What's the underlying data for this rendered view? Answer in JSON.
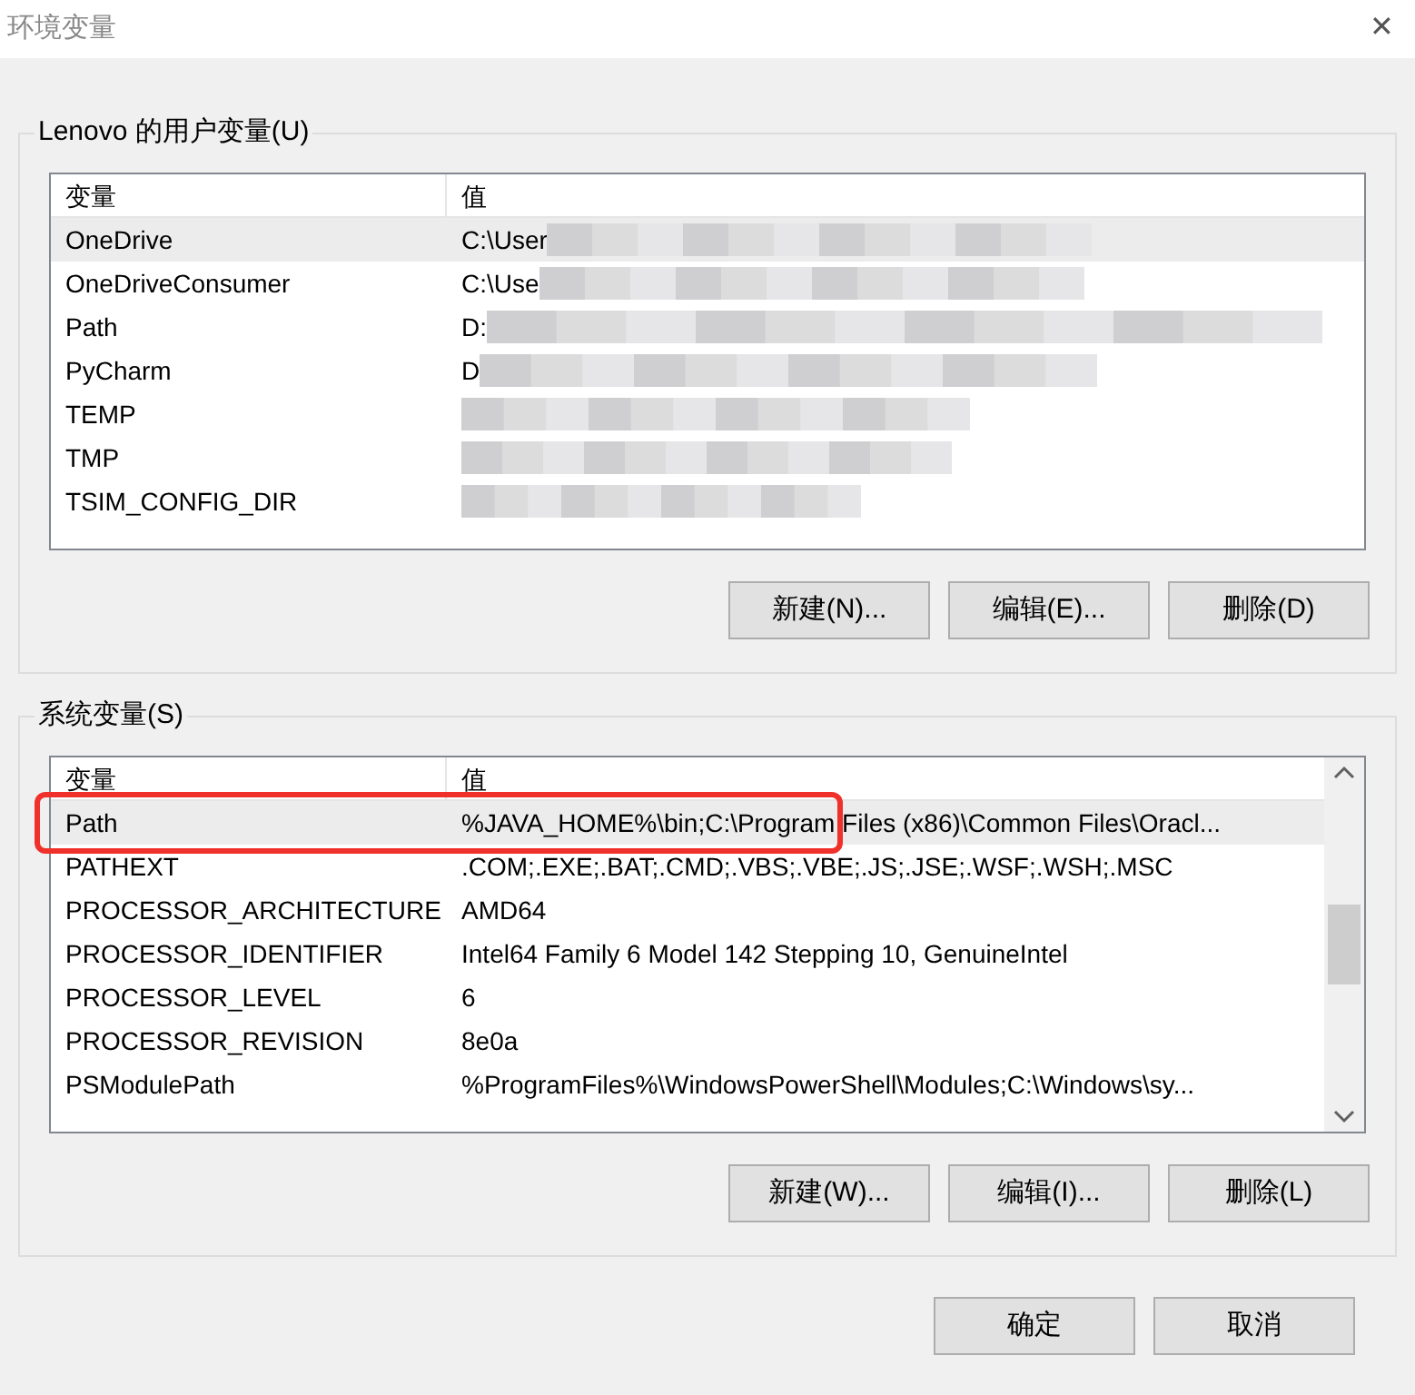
{
  "window": {
    "title": "环境变量",
    "close": "✕"
  },
  "user_vars": {
    "title": "Lenovo 的用户变量(U)",
    "columns": [
      "变量",
      "值"
    ],
    "rows": [
      {
        "name": "OneDrive",
        "value": "C:\\User",
        "redacted": true,
        "selected": true
      },
      {
        "name": "OneDriveConsumer",
        "value": "C:\\Use",
        "redacted": true,
        "selected": false
      },
      {
        "name": "Path",
        "value": "D:",
        "redacted": true,
        "selected": false
      },
      {
        "name": "PyCharm",
        "value": "D",
        "redacted": true,
        "selected": false
      },
      {
        "name": "TEMP",
        "value": "",
        "redacted": true,
        "selected": false
      },
      {
        "name": "TMP",
        "value": "",
        "redacted": true,
        "selected": false
      },
      {
        "name": "TSIM_CONFIG_DIR",
        "value": "",
        "redacted": true,
        "selected": false
      }
    ],
    "buttons": [
      "新建(N)...",
      "编辑(E)...",
      "删除(D)"
    ]
  },
  "system_vars": {
    "title": "系统变量(S)",
    "columns": [
      "变量",
      "值"
    ],
    "rows": [
      {
        "name": "Path",
        "value": "%JAVA_HOME%\\bin;C:\\Program Files (x86)\\Common Files\\Oracl...",
        "redacted": false,
        "selected": true,
        "marked": true
      },
      {
        "name": "PATHEXT",
        "value": ".COM;.EXE;.BAT;.CMD;.VBS;.VBE;.JS;.JSE;.WSF;.WSH;.MSC",
        "redacted": false,
        "selected": false,
        "marked": false
      },
      {
        "name": "PROCESSOR_ARCHITECTURE",
        "value": "AMD64",
        "redacted": false,
        "selected": false,
        "marked": false
      },
      {
        "name": "PROCESSOR_IDENTIFIER",
        "value": "Intel64 Family 6 Model 142 Stepping 10, GenuineIntel",
        "redacted": false,
        "selected": false,
        "marked": false
      },
      {
        "name": "PROCESSOR_LEVEL",
        "value": "6",
        "redacted": false,
        "selected": false,
        "marked": false
      },
      {
        "name": "PROCESSOR_REVISION",
        "value": "8e0a",
        "redacted": false,
        "selected": false,
        "marked": false
      },
      {
        "name": "PSModulePath",
        "value": "%ProgramFiles%\\WindowsPowerShell\\Modules;C:\\Windows\\sy...",
        "redacted": false,
        "selected": false,
        "marked": false
      }
    ],
    "buttons": [
      "新建(W)...",
      "编辑(I)...",
      "删除(L)"
    ]
  },
  "buttons": [
    "确定",
    "取消"
  ]
}
